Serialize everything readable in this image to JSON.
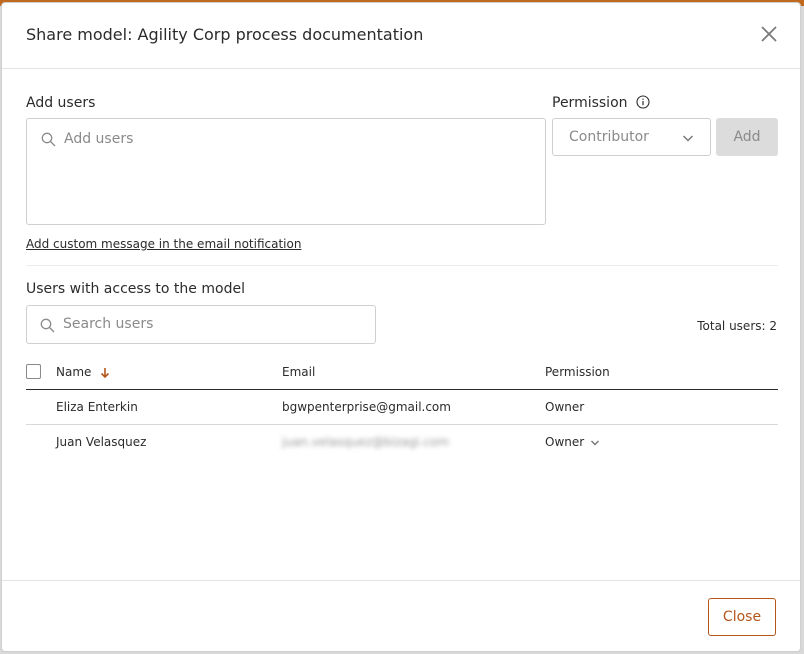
{
  "dialog": {
    "title": "Share model: Agility Corp process documentation",
    "close_label": "Close"
  },
  "add_users": {
    "label": "Add users",
    "placeholder": "Add users",
    "custom_message_link": "Add custom message in the email notification"
  },
  "permission": {
    "label": "Permission",
    "selected": "Contributor",
    "add_button": "Add"
  },
  "access": {
    "heading": "Users with access to the model",
    "search_placeholder": "Search users",
    "total_users": "Total users: 2",
    "columns": {
      "name": "Name",
      "email": "Email",
      "permission": "Permission"
    },
    "rows": [
      {
        "name": "Eliza Enterkin",
        "email": "bgwpenterprise@gmail.com",
        "permission": "Owner"
      },
      {
        "name": "Juan Velasquez",
        "email": "juan.velasquez@bizagi.com",
        "permission": "Owner"
      }
    ]
  },
  "colors": {
    "accent": "#b5561a",
    "top_bar": "#c0691f"
  },
  "icons": [
    "close-icon",
    "search-icon",
    "info-icon",
    "chevron-down-icon",
    "sort-down-arrow-icon"
  ]
}
